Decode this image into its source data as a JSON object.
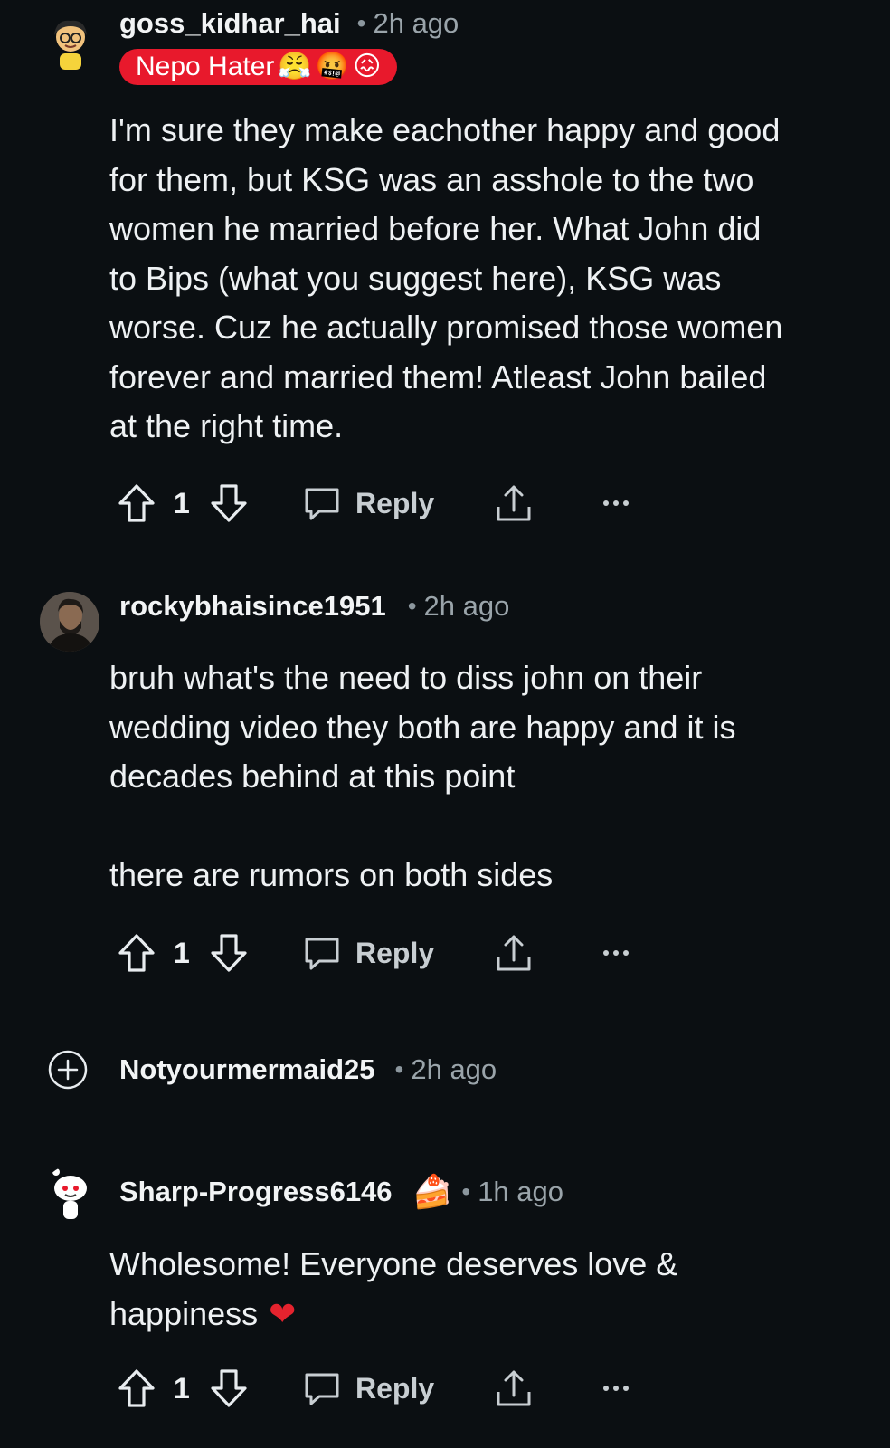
{
  "comments": [
    {
      "username": "goss_kidhar_hai",
      "time": "2h ago",
      "flair": "Nepo Hater",
      "body": "I'm sure they make eachother happy and good\nfor them, but KSG was an asshole to the two\nwomen he married before her. What John did\nto Bips (what you suggest here), KSG was\nworse. Cuz he actually promised those women\nforever and married them! Atleast John bailed\nat the right time.",
      "votes": "1",
      "reply_label": "Reply"
    },
    {
      "username": "rockybhaisince1951",
      "time": "2h ago",
      "body": "bruh what's the need to diss john on their\nwedding video they both are happy and it is\ndecades behind at this point\n\nthere are rumors on both sides",
      "votes": "1",
      "reply_label": "Reply"
    },
    {
      "username": "Notyourmermaid25",
      "time": "2h ago",
      "collapsed": true
    },
    {
      "username": "Sharp-Progress6146",
      "time": "1h ago",
      "body": "Wholesome! Everyone deserves love &\nhappiness",
      "votes": "1",
      "reply_label": "Reply"
    }
  ],
  "colors": {
    "background": "#0b0f12",
    "flair": "#e8192c",
    "text": "#eef1f3",
    "muted": "#9aa4aa"
  },
  "icons": [
    "upvote-icon",
    "downvote-icon",
    "comment-icon",
    "share-icon",
    "more-icon",
    "expand-icon",
    "heart-emoji",
    "cake-emoji"
  ]
}
